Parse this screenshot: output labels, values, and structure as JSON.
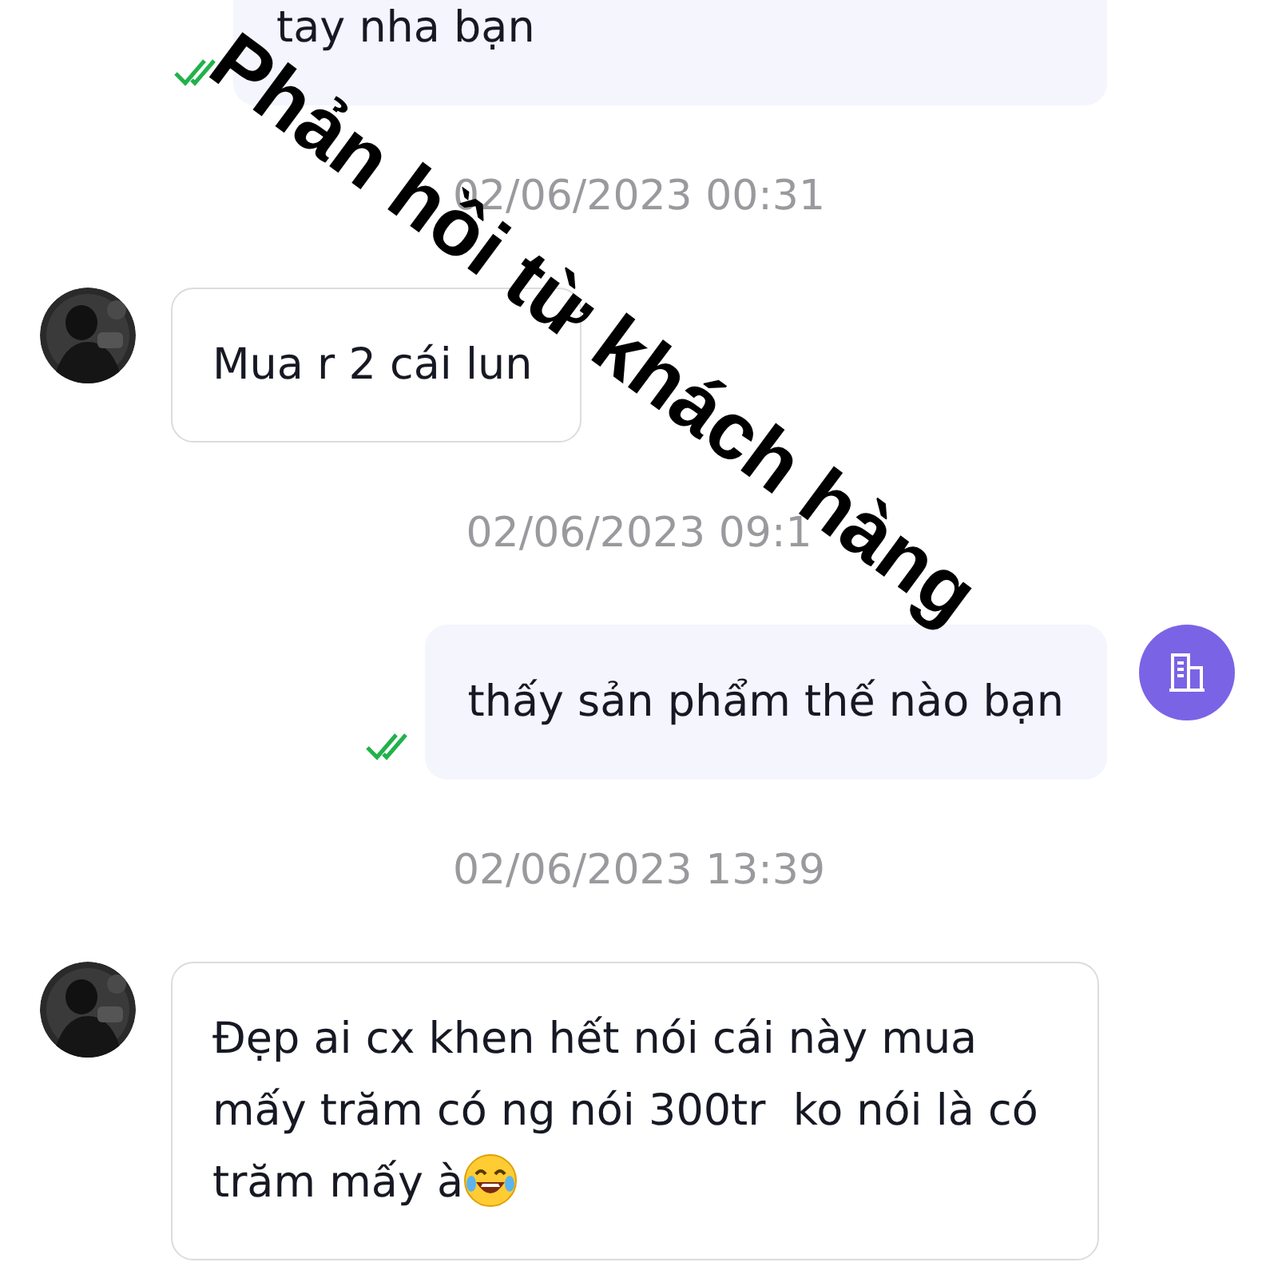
{
  "messages": [
    {
      "kind": "outgoing",
      "text": "tay nha bạn",
      "seen": true,
      "avatar": false
    },
    {
      "kind": "timestamp",
      "text": "02/06/2023 00:31"
    },
    {
      "kind": "incoming",
      "text": "Mua r 2 cái lun"
    },
    {
      "kind": "timestamp",
      "text": "02/06/2023 09:1"
    },
    {
      "kind": "outgoing",
      "text": "thấy sản phẩm thế nào bạn",
      "seen": true,
      "avatar": true
    },
    {
      "kind": "timestamp",
      "text": "02/06/2023 13:39"
    },
    {
      "kind": "incoming",
      "text": "Đẹp ai cx khen hết nói cái này mua mấy trăm có ng nói 300tr  ko nói là có trăm mấy à",
      "emoji": true
    }
  ],
  "overlay": {
    "text": "Phản hồi từ khách hàng"
  }
}
